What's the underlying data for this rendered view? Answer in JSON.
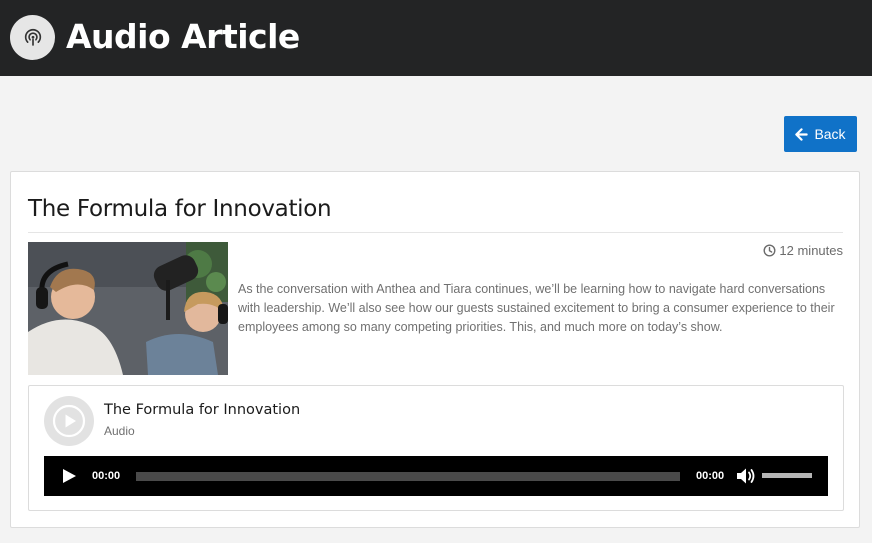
{
  "header": {
    "title": "Audio Article",
    "logo_icon": "podcast-icon",
    "background": "#232425"
  },
  "toolbar": {
    "back_label": "Back",
    "back_icon": "arrow-left-icon",
    "accent": "#1072c8"
  },
  "article": {
    "title": "The Formula for Innovation",
    "duration": "12 minutes",
    "duration_icon": "clock-icon",
    "thumbnail_icon": "podcast-hosts-photo",
    "description": "As the conversation with Anthea and Tiara continues, we’ll be learning how to navigate hard conversations with leadership. We’ll also see how our guests sustained excitement to bring a consumer experience to their employees among so many competing priorities. This, and much more on today’s show."
  },
  "player": {
    "title": "The Formula for Innovation",
    "subtitle": "Audio",
    "current_time": "00:00",
    "total_time": "00:00",
    "progress": 0,
    "volume": 1,
    "play_icon": "play-icon",
    "volume_icon": "volume-icon"
  }
}
